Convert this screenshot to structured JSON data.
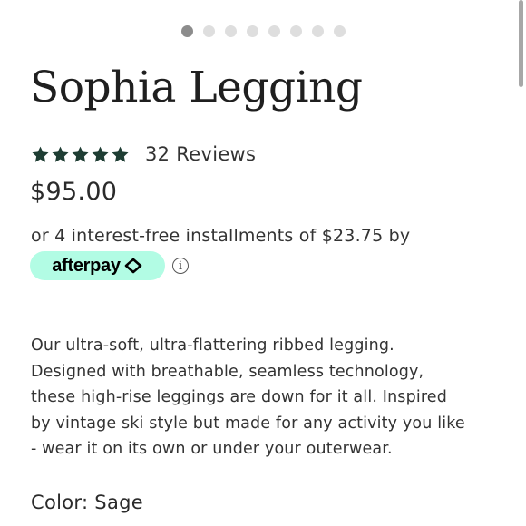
{
  "carousel": {
    "slide_count": 8,
    "active_index": 0
  },
  "product": {
    "title": "Sophia Legging",
    "rating": 5,
    "rating_max": 5,
    "reviews_label": "32 Reviews",
    "price": "$95.00"
  },
  "payment": {
    "installments_text": "or 4 interest-free installments of $23.75 by",
    "afterpay_label": "afterpay",
    "info_glyph": "i",
    "afterpay_color": "#b2fce4"
  },
  "description": {
    "lines": [
      "Our ultra-soft, ultra-flattering ribbed legging.",
      "Designed with breathable, seamless technology,",
      "these high-rise leggings are down for it all. Inspired",
      "by vintage ski style but made for any activity you like",
      "- wear it on its own or under your outerwear."
    ]
  },
  "color": {
    "label": "Color: Sage"
  },
  "colors": {
    "star": "#1e3d33",
    "text": "#333333"
  }
}
